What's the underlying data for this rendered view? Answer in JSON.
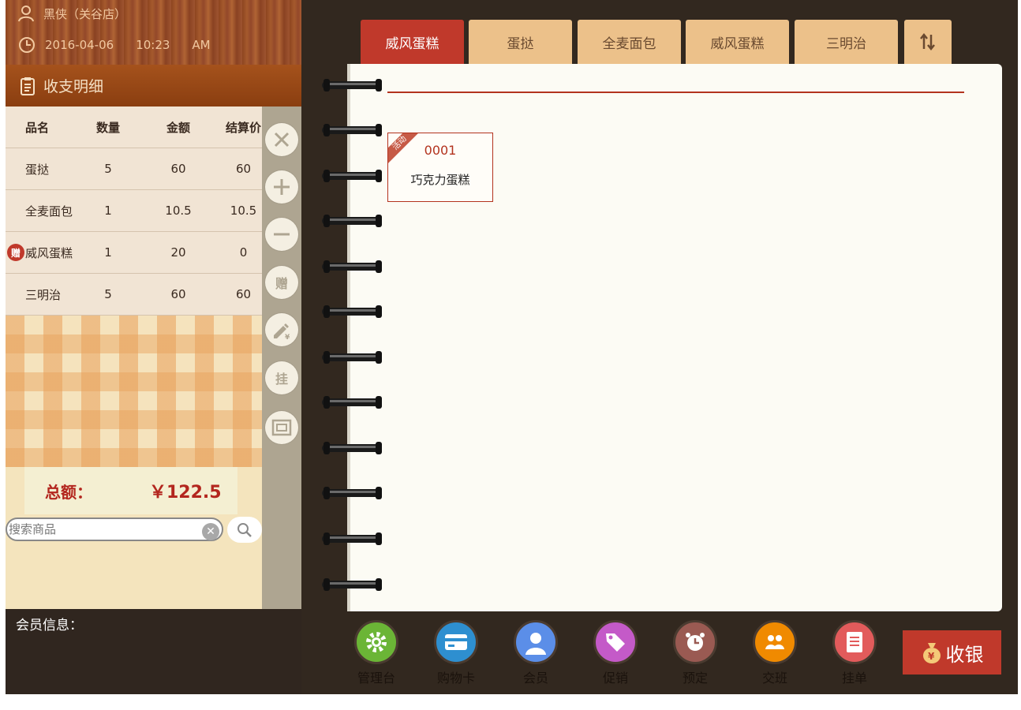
{
  "header": {
    "user": "黑侠（关谷店）",
    "date": "2016-04-06",
    "time": "10:23",
    "ampm": "AM"
  },
  "ledger": {
    "title": "收支明细"
  },
  "order_table": {
    "columns": [
      "品名",
      "数量",
      "金额",
      "结算价"
    ],
    "rows": [
      {
        "name": "蛋挞",
        "qty": "5",
        "amount": "60",
        "settle": "60",
        "gift": false
      },
      {
        "name": "全麦面包",
        "qty": "1",
        "amount": "10.5",
        "settle": "10.5",
        "gift": false
      },
      {
        "name": "威风蛋糕",
        "qty": "1",
        "amount": "20",
        "settle": "0",
        "gift": true
      },
      {
        "name": "三明治",
        "qty": "5",
        "amount": "60",
        "settle": "60",
        "gift": false
      }
    ],
    "gift_badge": "赠"
  },
  "actions": {
    "gift": "赠",
    "hang": "挂"
  },
  "total": {
    "label": "总额：",
    "value": "￥122.5"
  },
  "search": {
    "placeholder": "搜索商品"
  },
  "member": {
    "label": "会员信息："
  },
  "tabs": [
    {
      "label": "威风蛋糕",
      "active": true
    },
    {
      "label": "蛋挞",
      "active": false
    },
    {
      "label": "全麦面包",
      "active": false
    },
    {
      "label": "威风蛋糕",
      "active": false
    },
    {
      "label": "三明治",
      "active": false
    }
  ],
  "product": {
    "ribbon": "活动",
    "code": "0001",
    "name": "巧克力蛋糕"
  },
  "bottom_nav": [
    {
      "label": "管理台",
      "icon": "gear-icon",
      "color": "#6bb536"
    },
    {
      "label": "购物卡",
      "icon": "card-icon",
      "color": "#2e8fd0"
    },
    {
      "label": "会员",
      "icon": "user-icon",
      "color": "#5b8ee8"
    },
    {
      "label": "促销",
      "icon": "tag-icon",
      "color": "#c45ac8"
    },
    {
      "label": "预定",
      "icon": "clock-icon",
      "color": "#9a5a52"
    },
    {
      "label": "交班",
      "icon": "shift-icon",
      "color": "#f08a00"
    },
    {
      "label": "挂单",
      "icon": "receipt-icon",
      "color": "#e25b5b"
    }
  ],
  "checkout": {
    "label": "收银"
  },
  "colors": {
    "accent_red": "#c0392b",
    "tab_tan": "#ecc18a",
    "dark_bg": "#32281f"
  }
}
